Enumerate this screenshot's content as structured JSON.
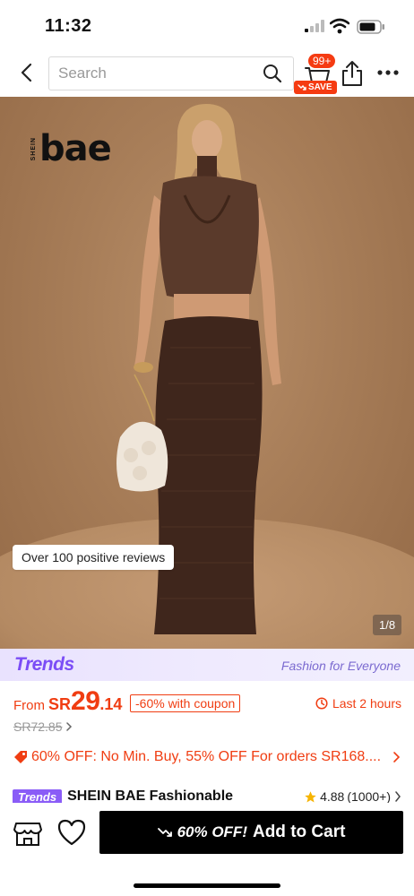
{
  "status_bar": {
    "time": "11:32"
  },
  "nav": {
    "search_placeholder": "Search",
    "cart_badge": "99+",
    "save_badge": "SAVE"
  },
  "hero": {
    "brand_small": "SHEIN",
    "brand_large": "bae",
    "reviews_chip": "Over 100 positive reviews",
    "image_counter": "1/8"
  },
  "trends_banner": {
    "logo": "Trends",
    "tagline": "Fashion for Everyone"
  },
  "price": {
    "from_label": "From",
    "currency": "SR",
    "integer": "29",
    "decimal": ".14",
    "coupon": "-60% with coupon",
    "timer": "Last 2 hours",
    "original": "SR72.85"
  },
  "promo": {
    "text": "60% OFF: No Min. Buy,  55% OFF For orders SR168...."
  },
  "product": {
    "badge": "Trends",
    "title": "SHEIN BAE Fashionable",
    "rating": "4.88",
    "review_count": "(1000+)"
  },
  "bottom_bar": {
    "discount": "60% OFF!",
    "add_to_cart": "Add to Cart"
  },
  "colors": {
    "accent": "#f03d12",
    "trends_purple": "#7b4df6",
    "button_bg": "#000000"
  }
}
